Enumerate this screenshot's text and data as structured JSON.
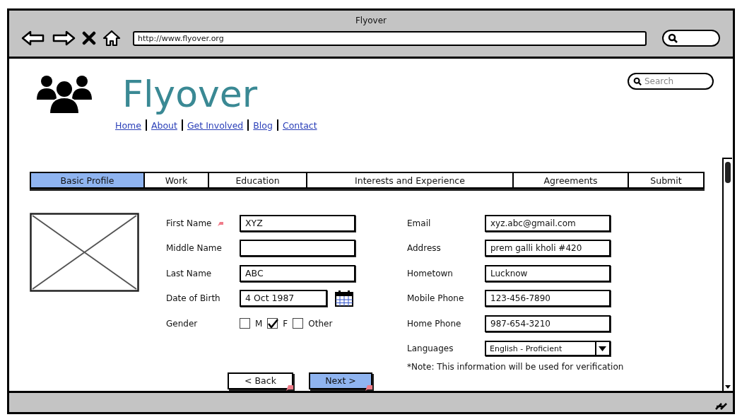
{
  "window": {
    "title": "Flyover",
    "url": "http://www.flyover.org"
  },
  "site": {
    "name": "Flyover",
    "nav": [
      "Home",
      "About",
      "Get Involved",
      "Blog",
      "Contact"
    ],
    "search": {
      "placeholder": "Search"
    }
  },
  "tabs": [
    {
      "label": "Basic Profile",
      "selected": true
    },
    {
      "label": "Work",
      "selected": false
    },
    {
      "label": "Education",
      "selected": false
    },
    {
      "label": "Interests and Experience",
      "selected": false
    },
    {
      "label": "Agreements",
      "selected": false
    },
    {
      "label": "Submit",
      "selected": false
    }
  ],
  "left_fields": [
    {
      "kind": "text",
      "label": "First Name",
      "value": "XYZ",
      "linked": true
    },
    {
      "kind": "text",
      "label": "Middle Name",
      "linked": false
    },
    {
      "kind": "text",
      "label": "Last Name",
      "value": "ABC",
      "linked": false
    },
    {
      "kind": "date",
      "label": "Date of Birth",
      "value": "4 Oct 1987",
      "linked": false
    },
    {
      "kind": "checkboxes",
      "label": "Gender",
      "linked": false,
      "options": [
        {
          "label": "M",
          "checked": false
        },
        {
          "label": "F",
          "checked": true
        },
        {
          "label": "Other",
          "checked": false
        }
      ]
    }
  ],
  "right_fields": [
    {
      "kind": "text",
      "label": "Email",
      "value": "xyz.abc@gmail.com"
    },
    {
      "kind": "text",
      "label": "Address",
      "value": "prem galli kholi #420"
    },
    {
      "kind": "text",
      "label": "Hometown",
      "value": "Lucknow"
    },
    {
      "kind": "text",
      "label": "Mobile Phone",
      "value": "123-456-7890"
    },
    {
      "kind": "text",
      "label": "Home Phone",
      "value": "987-654-3210"
    },
    {
      "kind": "dropdown",
      "label": "Languages",
      "value": "English - Proficient"
    }
  ],
  "note": "*Note: This information will be used for verification",
  "buttons": [
    {
      "label": "< Back",
      "primary": false,
      "linked": true
    },
    {
      "label": "Next >",
      "primary": true,
      "linked": true
    }
  ]
}
